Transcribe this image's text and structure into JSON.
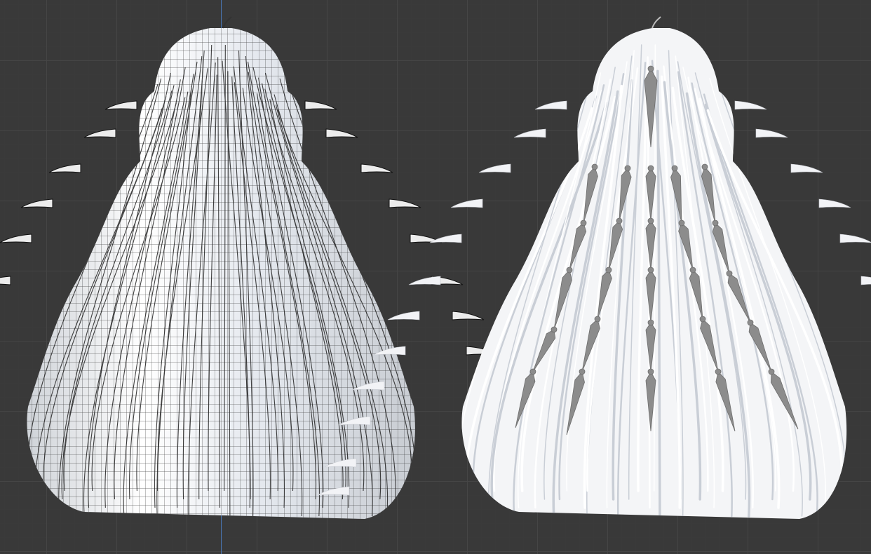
{
  "viewport": {
    "background": "#393939",
    "grid_color": "#464646",
    "axis_color": "#4a78b8",
    "objects": [
      {
        "name": "hair-mesh-wireframe",
        "shading": "wireframe-overlay",
        "color": "#e8e8e8"
      },
      {
        "name": "hair-mesh-rendered-with-bones",
        "shading": "material-preview",
        "color": "#f2f2f2",
        "bone_color": "#8c8c8c"
      }
    ]
  }
}
